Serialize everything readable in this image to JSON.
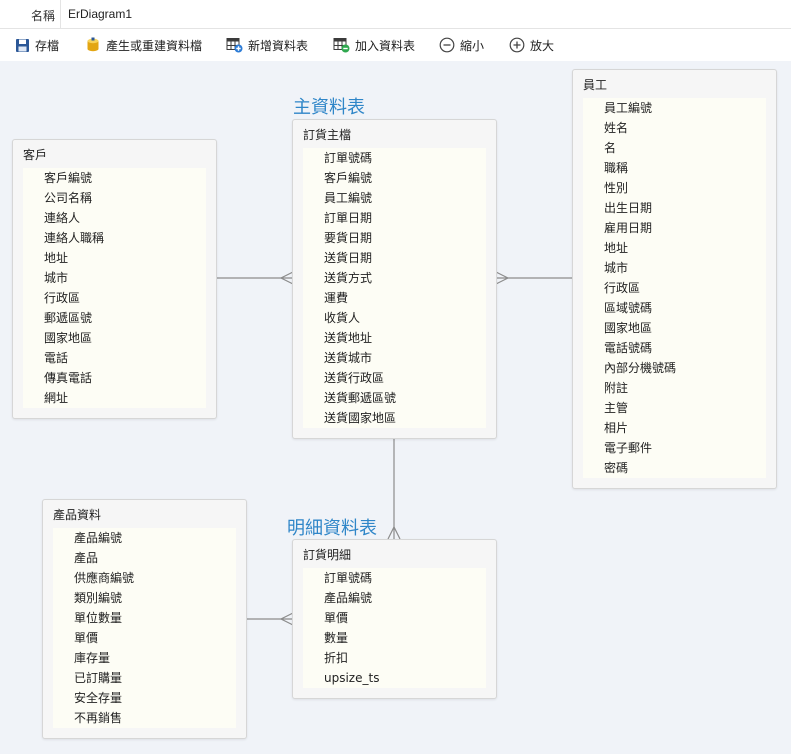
{
  "namebar": {
    "label": "名稱",
    "value": "ErDiagram1"
  },
  "toolbar": {
    "save": "存檔",
    "generate": "產生或重建資料檔",
    "new_table": "新增資料表",
    "add_table": "加入資料表",
    "zoom_out": "縮小",
    "zoom_in": "放大"
  },
  "groups": {
    "main": "主資料表",
    "detail": "明細資料表"
  },
  "tables": {
    "customers": {
      "title": "客戶",
      "fields": [
        "客戶編號",
        "公司名稱",
        "連絡人",
        "連絡人職稱",
        "地址",
        "城市",
        "行政區",
        "郵遞區號",
        "國家地區",
        "電話",
        "傳真電話",
        "網址"
      ]
    },
    "orders": {
      "title": "訂貨主檔",
      "fields": [
        "訂單號碼",
        "客戶編號",
        "員工編號",
        "訂單日期",
        "要貨日期",
        "送貨日期",
        "送貨方式",
        "運費",
        "收貨人",
        "送貨地址",
        "送貨城市",
        "送貨行政區",
        "送貨郵遞區號",
        "送貨國家地區"
      ]
    },
    "employees": {
      "title": "員工",
      "fields": [
        "員工編號",
        "姓名",
        "名",
        "職稱",
        "性別",
        "出生日期",
        "雇用日期",
        "地址",
        "城市",
        "行政區",
        "區域號碼",
        "國家地區",
        "電話號碼",
        "內部分機號碼",
        "附註",
        "主管",
        "相片",
        "電子郵件",
        "密碼"
      ]
    },
    "products": {
      "title": "產品資料",
      "fields": [
        "產品編號",
        "產品",
        "供應商編號",
        "類別編號",
        "單位數量",
        "單價",
        "庫存量",
        "已訂購量",
        "安全存量",
        "不再銷售"
      ]
    },
    "order_details": {
      "title": "訂貨明細",
      "fields": [
        "訂單號碼",
        "產品編號",
        "單價",
        "數量",
        "折扣",
        "upsize_ts"
      ]
    }
  }
}
